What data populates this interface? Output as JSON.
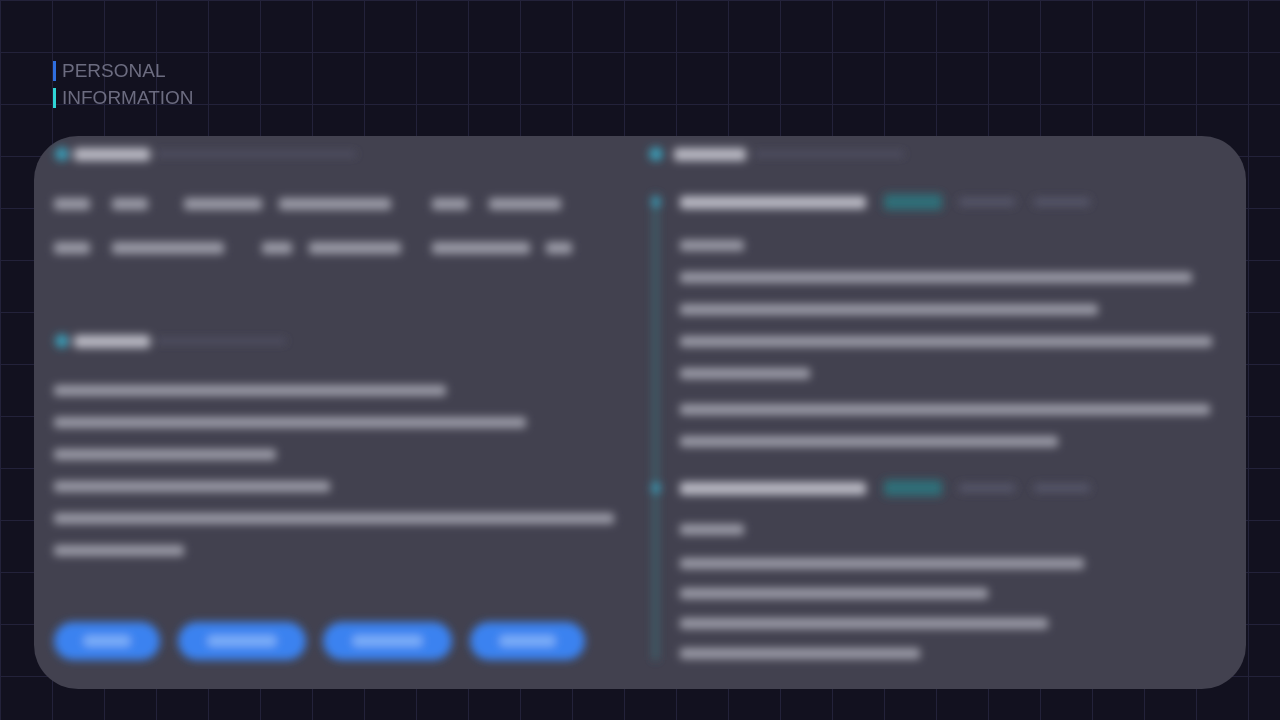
{
  "heading": {
    "lines": [
      {
        "text": "PERSONAL",
        "color": "#2f6fe0"
      },
      {
        "text": "INFORMATION",
        "color": "#2fd6d6"
      }
    ]
  }
}
